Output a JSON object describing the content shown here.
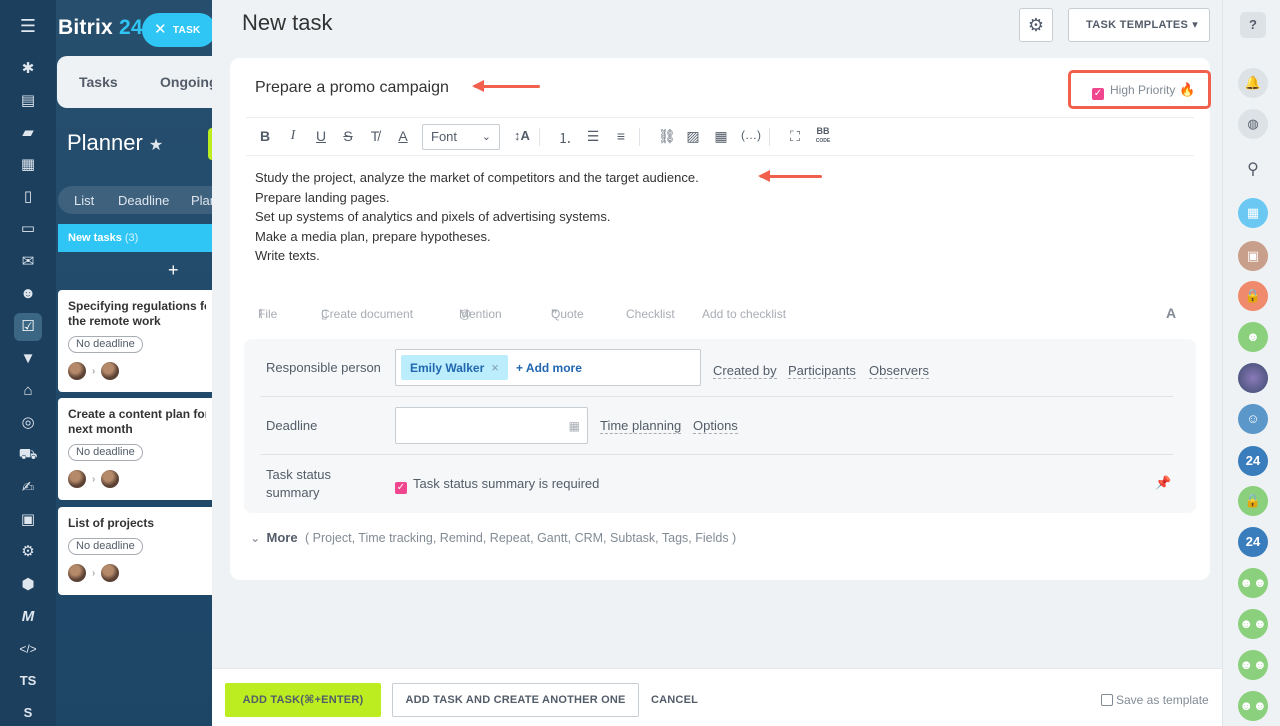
{
  "app": {
    "logo_text": "Bitrix",
    "logo_num": "24"
  },
  "left_rail": {
    "icons": [
      "menu-icon",
      "feed-icon",
      "tasks-icon",
      "chat-icon",
      "calendar-icon",
      "docs-icon",
      "drive-icon",
      "mail-icon",
      "employees-icon",
      "tasks-active-icon",
      "crm-filter-icon",
      "company-icon",
      "goals-icon",
      "shop-icon",
      "sign-icon",
      "contacts-icon",
      "automation-icon",
      "box-icon",
      "marketing-icon",
      "dev-icon"
    ],
    "ts_label": "TS",
    "s_label": "S"
  },
  "background": {
    "task_pill": "TASK",
    "tabs": [
      "Tasks",
      "Ongoing"
    ],
    "planner_title": "Planner",
    "subtabs": [
      "List",
      "Deadline",
      "Plan"
    ],
    "column_title": "New tasks",
    "column_count": "(3)",
    "cards": [
      {
        "title": "Specifying regulations for the remote work",
        "line1": "Specifying regulations for",
        "line2": "the remote work",
        "badge": "No deadline"
      },
      {
        "title": "Create a content plan for the next month",
        "line1": "Create a content plan for t",
        "line2": "next month",
        "badge": "No deadline"
      },
      {
        "title": "List of projects",
        "line1": "List of projects",
        "line2": "",
        "badge": "No deadline"
      }
    ]
  },
  "panel": {
    "title": "New task",
    "templates_label": "TASK TEMPLATES",
    "task_name": "Prepare a promo campaign",
    "high_priority_label": "High Priority",
    "toolbar": {
      "font_label": "Font",
      "bbcode_top": "BB",
      "bbcode_bottom": "CODE"
    },
    "description": [
      "Study the project, analyze the market of competitors and the target audience.",
      "Prepare landing pages.",
      "Set up systems of analytics and pixels of advertising systems.",
      "Make a media plan, prepare hypotheses.",
      "Write texts."
    ],
    "attachments": {
      "file": "File",
      "create_document": "Create document",
      "mention": "Mention",
      "quote": "Quote",
      "checklist": "Checklist",
      "add_to_checklist": "Add to checklist",
      "format": "A"
    },
    "responsible": {
      "label": "Responsible person",
      "person": "Emily Walker",
      "add_more": "+ Add more",
      "created_by": "Created by",
      "participants": "Participants",
      "observers": "Observers"
    },
    "deadline": {
      "label": "Deadline",
      "value": "",
      "time_planning": "Time planning",
      "options": "Options"
    },
    "status_summary": {
      "label_line1": "Task status",
      "label_line2": "summary",
      "checkbox_label": "Task status summary is required"
    },
    "more": {
      "label": "More",
      "items": "( Project,  Time tracking,  Remind,  Repeat,  Gantt,  CRM,  Subtask,  Tags,  Fields )"
    }
  },
  "bottom": {
    "add_task": "ADD TASK(⌘+ENTER)",
    "add_another": "ADD TASK AND CREATE ANOTHER ONE",
    "cancel": "CANCEL",
    "save_template": "Save as template"
  },
  "right_rail": {
    "help": "?",
    "badge_24": "24"
  },
  "colors": {
    "accent_blue": "#2fc6f6",
    "add_green": "#bbed21",
    "annotation_red": "#f0604d",
    "checkbox_pink": "#f0468e",
    "rail_dark": "#1c3f5e"
  }
}
